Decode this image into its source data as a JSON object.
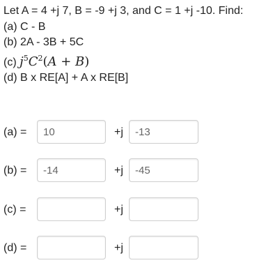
{
  "problem": {
    "intro": "Let A = 4 +j 7, B = -9 +j 3, and C = 1 +j -10. Find:",
    "part_a": "(a) C - B",
    "part_b": "(b) 2A - 3B + 5C",
    "part_c_label": "(c)",
    "part_c_expr": "j⁵C²(A + B)",
    "part_d": "(d) B x RE[A] + A x RE[B]"
  },
  "answers": [
    {
      "label": "(a) =",
      "real": "10",
      "imag": "-13",
      "j": "+j"
    },
    {
      "label": "(b) =",
      "real": "-14",
      "imag": "-45",
      "j": "+j"
    },
    {
      "label": "(c) =",
      "real": "",
      "imag": "",
      "j": "+j"
    },
    {
      "label": "(d) =",
      "real": "",
      "imag": "",
      "j": "+j"
    }
  ]
}
